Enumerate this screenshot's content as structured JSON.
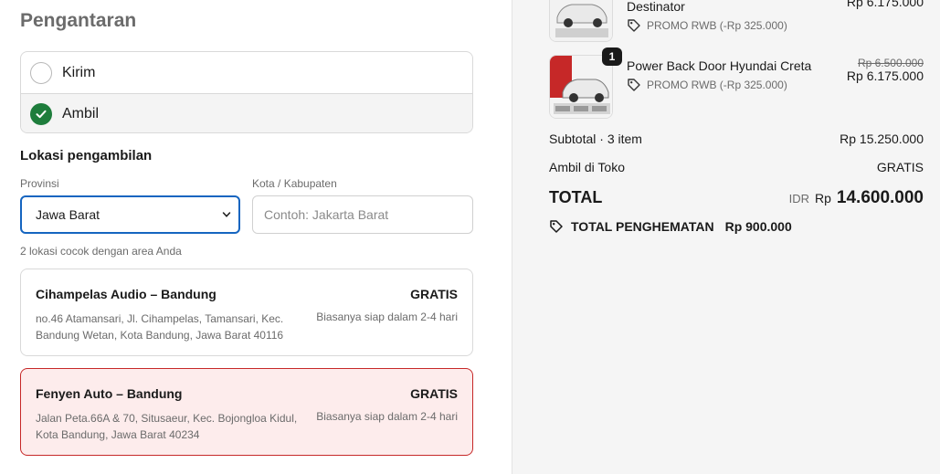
{
  "delivery": {
    "title": "Pengantaran",
    "options": [
      {
        "label": "Kirim",
        "selected": false
      },
      {
        "label": "Ambil",
        "selected": true
      }
    ]
  },
  "pickup": {
    "heading": "Lokasi pengambilan",
    "province_label": "Provinsi",
    "province_value": "Jawa Barat",
    "city_label": "Kota / Kabupaten",
    "city_placeholder": "Contoh: Jakarta Barat",
    "city_value": "",
    "match_hint": "2 lokasi cocok dengan area Anda",
    "locations": [
      {
        "name": "Cihampelas Audio – Bandung",
        "price": "GRATIS",
        "address": "no.46 Atamansari, Jl. Cihampelas, Tamansari, Kec. Bandung Wetan, Kota Bandung, Jawa Barat 40116",
        "eta": "Biasanya siap dalam 2-4 hari",
        "selected": false
      },
      {
        "name": "Fenyen Auto – Bandung",
        "price": "GRATIS",
        "address": "Jalan Peta.66A & 70, Situsaeur, Kec. Bojongloa Kidul, Kota Bandung, Jawa Barat 40234",
        "eta": "Biasanya siap dalam 2-4 hari",
        "selected": true
      }
    ]
  },
  "summary": {
    "items": [
      {
        "name": "Destinator",
        "promo": "PROMO RWB (-Rp 325.000)",
        "original_price": "",
        "price": "Rp 6.175.000"
      },
      {
        "name": "Power Back Door Hyundai Creta",
        "promo": "PROMO RWB (-Rp 325.000)",
        "quantity": "1",
        "original_price": "Rp 6.500.000",
        "price": "Rp 6.175.000"
      }
    ],
    "subtotal_label": "Subtotal · 3 item",
    "subtotal_value": "Rp 15.250.000",
    "shipping_label": "Ambil di Toko",
    "shipping_value": "GRATIS",
    "total_label": "TOTAL",
    "total_currency": "IDR",
    "total_rp": "Rp",
    "total_amount": "14.600.000",
    "savings_label": "TOTAL PENGHEMATAN",
    "savings_value": "Rp 900.000"
  },
  "colors": {
    "accent_green": "#1e7d3c",
    "focus_blue": "#1565c0",
    "selected_red": "#c62828",
    "selected_bg": "#fdecec"
  }
}
